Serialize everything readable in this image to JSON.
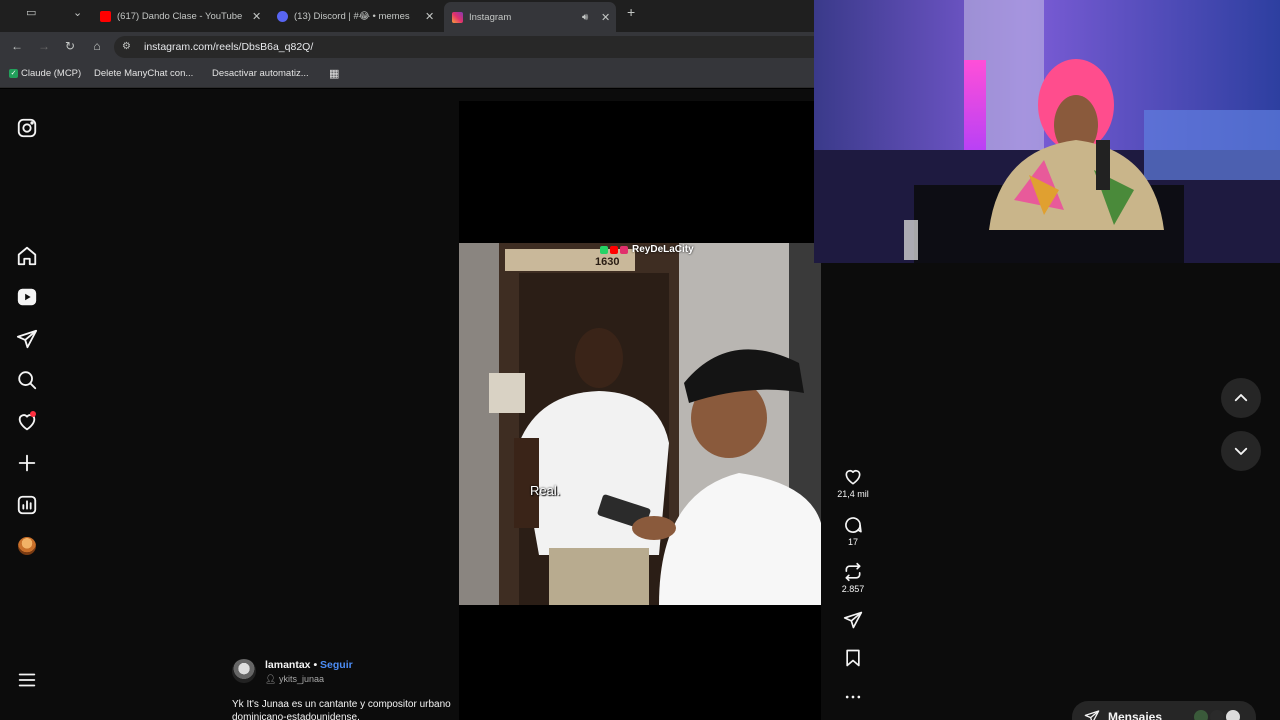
{
  "browser": {
    "tabs": [
      {
        "title": "(617) Dando Clase - YouTube",
        "favicon_color": "#ff0000"
      },
      {
        "title": "(13) Discord | #😂 • memes",
        "favicon_color": "#5865f2"
      },
      {
        "title": "Instagram",
        "favicon_color": "#e1306c",
        "active": true
      }
    ],
    "address_bar": {
      "url": "instagram.com/reels/DbsB6a_q82Q/"
    },
    "bookmarks": [
      "Claude (MCP)",
      "Delete ManyChat con...",
      "Desactivar automatiz..."
    ]
  },
  "sidebar": {
    "items": [
      {
        "name": "instagram-logo",
        "icon": "instagram-icon"
      },
      {
        "name": "home",
        "icon": "home-icon"
      },
      {
        "name": "reels",
        "icon": "reels-icon"
      },
      {
        "name": "messages",
        "icon": "paper-plane-icon"
      },
      {
        "name": "search",
        "icon": "search-icon"
      },
      {
        "name": "notifications",
        "icon": "heart-icon"
      },
      {
        "name": "create",
        "icon": "plus-icon"
      },
      {
        "name": "dashboard",
        "icon": "chart-icon"
      },
      {
        "name": "profile",
        "icon": "avatar"
      },
      {
        "name": "more",
        "icon": "menu-icon"
      }
    ]
  },
  "reel": {
    "watermark": "ReyDeLaCity",
    "subtitle": "Real.",
    "door_number": "1630",
    "author": {
      "username": "lamantax",
      "separator": " • ",
      "follow_label": "Seguir"
    },
    "audio": "ykits_junaa",
    "caption": "Yk It's Junaa es un cantante y compositor urbano dominicano-estadounidense.",
    "actions": {
      "likes": "21,4 mil",
      "comments": "17",
      "reposts": "2.857"
    }
  },
  "messages": {
    "label": "Mensajes"
  }
}
